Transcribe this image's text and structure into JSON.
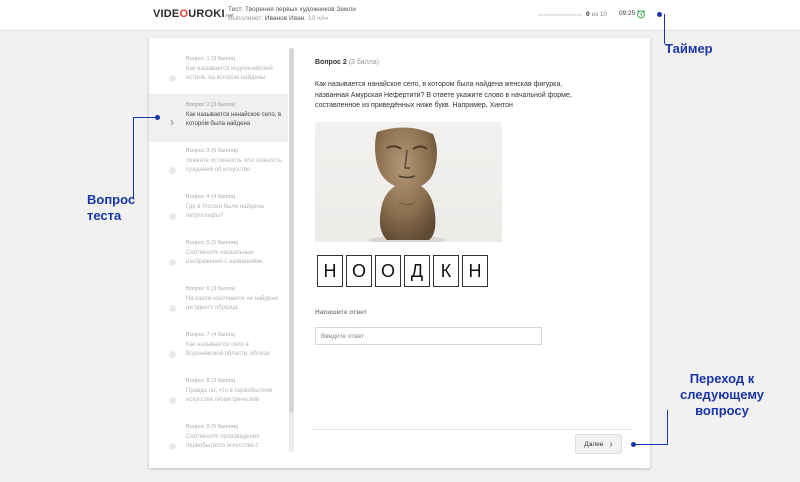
{
  "header": {
    "logo_pre": "VIDE",
    "logo_o": "O",
    "logo_post": "UROKI",
    "logo_suffix": ".net",
    "test_label": "Тест: Творения первых художников Земли",
    "performer_label": "Выполняет:",
    "performer_name": "Иванов Иван",
    "performer_class": ", 10 «А»",
    "progress_done": "0",
    "progress_rest": "из 10",
    "progress_fraction": 0,
    "timer": "09:25"
  },
  "sidebar": {
    "items": [
      {
        "head": "Вопрос 1 (3 балла)",
        "text": "Как называется индонезийский остров, на котором найдены",
        "active": false
      },
      {
        "head": "Вопрос 2 (3 балла)",
        "text": "Как называется нанайское село, в котором была найдена",
        "active": true
      },
      {
        "head": "Вопрос 3 (5 баллов)",
        "text": "Укажите истинность или ложность суждений об искусстве",
        "active": false
      },
      {
        "head": "Вопрос 4 (4 балла)",
        "text": "Где в России были найдены петроглифы?",
        "active": false
      },
      {
        "head": "Вопрос 5 (5 баллов)",
        "text": "Соотнесите наскальные изображения с названиями",
        "active": false
      },
      {
        "head": "Вопрос 6 (3 балла)",
        "text": "На каком континенте не найдено ни одного образца",
        "active": false
      },
      {
        "head": "Вопрос 7 (4 балла)",
        "text": "Как называется село в Воронежской области, вблизи",
        "active": false
      },
      {
        "head": "Вопрос 8 (3 балла)",
        "text": "Правда ли, что в первобытном искусстве геометрический",
        "active": false
      },
      {
        "head": "Вопрос 9 (5 баллов)",
        "text": "Соотнесите произведения первобытного искусства с",
        "active": false
      }
    ]
  },
  "question": {
    "number": "Вопрос 2",
    "points": "(3 балла)",
    "body": "Как называется нанайское село, в котором была найдена женская фигурка, названная Амурская Нефертити? В ответе укажите слово в начальной форме, составленное из приведённых ниже букв. Например, Хинтон",
    "letters": [
      "Н",
      "О",
      "О",
      "Д",
      "К",
      "Н"
    ],
    "answer_label": "Напишите ответ",
    "answer_placeholder": "Введите ответ",
    "answer_value": "",
    "next_label": "Далее"
  },
  "annotations": {
    "timer": "Таймер",
    "question": "Вопрос теста",
    "next": "Переход к следующему вопросу"
  },
  "colors": {
    "annotation": "#1a35a8",
    "timer_icon": "#3aa64a",
    "logo_accent": "#e63b2e"
  }
}
